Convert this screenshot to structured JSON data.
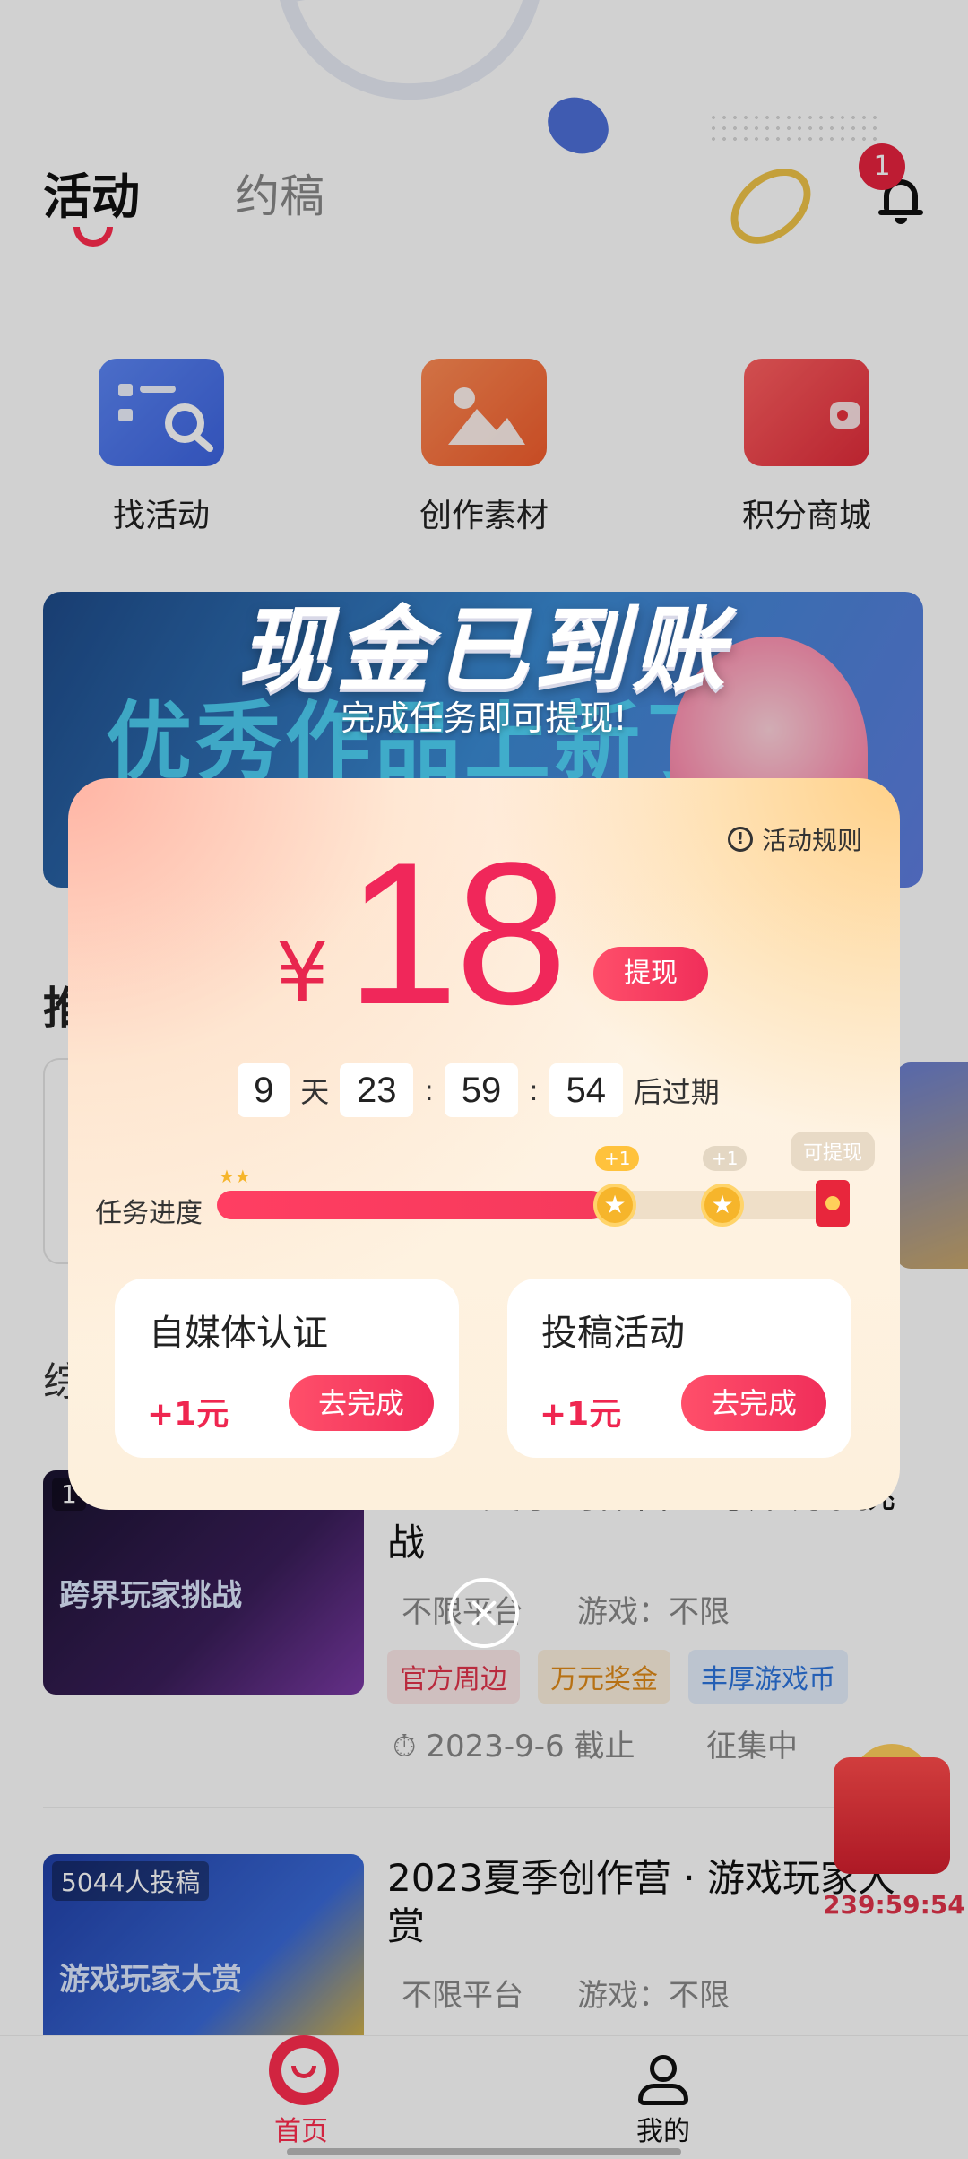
{
  "header": {
    "tabs": [
      {
        "label": "活动",
        "active": true
      },
      {
        "label": "约稿",
        "active": false
      }
    ],
    "notification_count": "1"
  },
  "quick_entries": [
    {
      "label": "找活动",
      "icon": "search-doc-icon",
      "color": "#4a74ea"
    },
    {
      "label": "创作素材",
      "icon": "image-folder-icon",
      "color": "#f36a3a"
    },
    {
      "label": "积分商城",
      "icon": "wallet-icon",
      "color": "#e8323e"
    }
  ],
  "banner": {
    "text": "优秀作品上新了"
  },
  "sections": {
    "recommend_partial": "推",
    "list_partial": "综"
  },
  "activities": [
    {
      "thumb_label": "1",
      "thumb_title": "跨界玩家挑战",
      "title": "2023夏季创作营 · 跨界玩家挑战",
      "platform": "不限平台",
      "game": "游戏：不限",
      "tags": [
        "官方周边",
        "万元奖金",
        "丰厚游戏币"
      ],
      "deadline": "2023-9-6 截止",
      "status": "征集中"
    },
    {
      "thumb_label": "5044人投稿",
      "thumb_title": "游戏玩家大赏",
      "title": "2023夏季创作营 · 游戏玩家大赏",
      "platform": "不限平台",
      "game": "游戏：不限"
    }
  ],
  "float_gift": {
    "timer": "239:59:54"
  },
  "bottom_nav": [
    {
      "label": "首页",
      "active": true
    },
    {
      "label": "我的",
      "active": false
    }
  ],
  "popup": {
    "headline": "现金已到账",
    "subline": "完成任务即可提现!",
    "rules_label": "活动规则",
    "currency": "¥",
    "amount": "18",
    "withdraw_label": "提现",
    "countdown": {
      "days": "9",
      "days_unit": "天",
      "hours": "23",
      "minutes": "59",
      "seconds": "54",
      "separator": ":",
      "suffix": "后过期"
    },
    "progress": {
      "label": "任务进度",
      "value": 0.62,
      "milestones": [
        {
          "bubble": "+1",
          "reached": true
        },
        {
          "bubble": "+1",
          "reached": false
        }
      ],
      "final_label": "可提现"
    },
    "tasks": [
      {
        "name": "自媒体认证",
        "reward": "+1元",
        "button": "去完成"
      },
      {
        "name": "投稿活动",
        "reward": "+1元",
        "button": "去完成"
      }
    ]
  },
  "colors": {
    "accent": "#f0275a",
    "brand_red": "#ff2d4f",
    "gold": "#f6b52b"
  }
}
